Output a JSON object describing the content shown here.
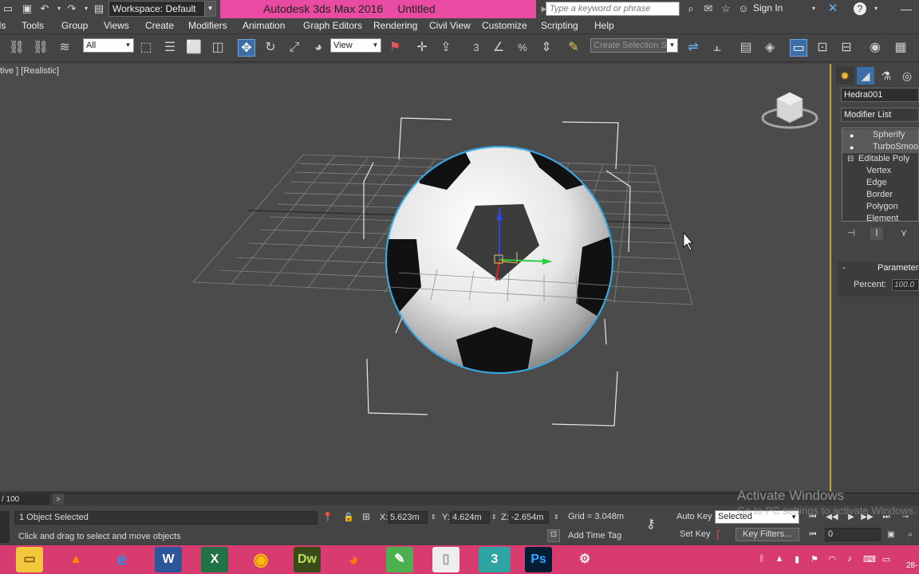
{
  "titlebar": {
    "workspace_label": "Workspace: Default",
    "app_name": "Autodesk 3ds Max 2016",
    "file_name": "Untitled",
    "search_placeholder": "Type a keyword or phrase",
    "sign_in": "Sign In"
  },
  "menus": [
    "ols",
    "Tools",
    "Group",
    "Views",
    "Create",
    "Modifiers",
    "Animation",
    "Graph Editors",
    "Rendering",
    "Civil View",
    "Customize",
    "Scripting",
    "Help"
  ],
  "toolbar": {
    "filter_value": "All",
    "refcoord_value": "View",
    "snaps": [
      "3",
      "%"
    ],
    "selection_set_placeholder": "Create Selection Se"
  },
  "viewport": {
    "label": "tive ] [Realistic]"
  },
  "command_panel": {
    "object_name": "Hedra001",
    "modifier_list": "Modifier List",
    "stack": [
      {
        "label": "Spherify",
        "bulb": true
      },
      {
        "label": "TurboSmooth",
        "bulb": true
      },
      {
        "label": "Editable Poly",
        "bulb": false,
        "expander": "⊟"
      },
      {
        "label": "Vertex",
        "bulb": false
      },
      {
        "label": "Edge",
        "bulb": false
      },
      {
        "label": "Border",
        "bulb": false
      },
      {
        "label": "Polygon",
        "bulb": false
      },
      {
        "label": "Element",
        "bulb": false
      }
    ],
    "rollout_toggle": "-",
    "params_title": "Parameters",
    "percent_label": "Percent:",
    "percent_value": "100.0"
  },
  "timeline": {
    "frame_label": "/ 100",
    "arrow": ">"
  },
  "status": {
    "selection_info": "1 Object Selected",
    "prompt": "Click and drag to select and move objects",
    "x_label": "X:",
    "x_value": "5.623m",
    "y_label": "Y:",
    "y_value": "4.624m",
    "z_label": "Z:",
    "z_value": "-2.654m",
    "grid": "Grid = 3.048m",
    "add_time_tag": "Add Time Tag",
    "auto_key": "Auto Key",
    "set_key": "Set Key",
    "selected_dd": "Selected",
    "key_filters": "Key Filters...",
    "frame_value": "0"
  },
  "watermark": {
    "line1": "Activate Windows",
    "line2": "Go to PC settings to activate Windows."
  },
  "taskbar": {
    "dreamweaver": "Dw",
    "photoshop": "Ps",
    "clock": "28-"
  },
  "colors": {
    "title_pink": "#e94ba3",
    "taskbar_pink": "#d83b6f",
    "selection_blue": "#3a6ea5",
    "viewport_border": "#c8a33c",
    "ball_highlight": "#3aa7e0"
  }
}
